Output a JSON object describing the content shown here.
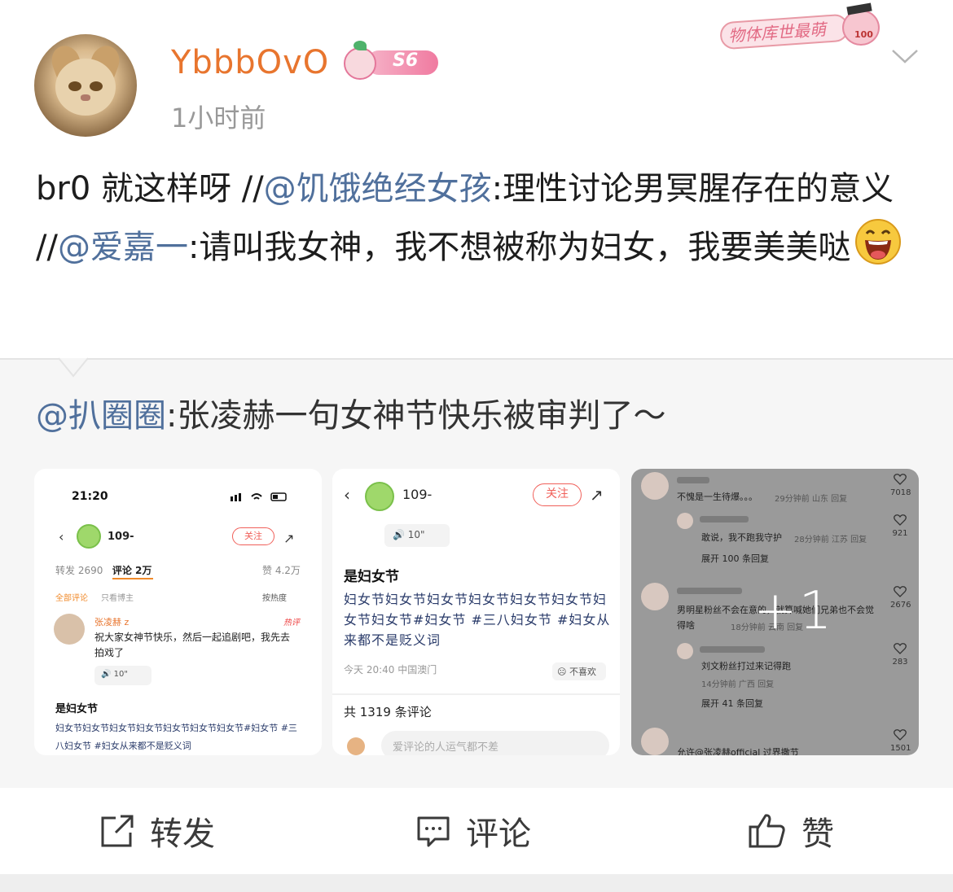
{
  "post": {
    "username": "YbbbOvO",
    "level_badge": "S6",
    "time": "1小时前",
    "stamp_text": "物体库世最萌",
    "stamp_num": "100",
    "text_1": "br0 就这样呀 //",
    "mention_1": "@饥饿绝经女孩",
    "text_2": ":理性讨论男冥腥存在的意义 //",
    "mention_2": "@爱嘉一",
    "text_3": ":请叫我女神，我不想被称为妇女，我要美美哒"
  },
  "repost": {
    "mention": "@扒圈圈",
    "text": ":张凌赫一句女神节快乐被审判了～",
    "image_more": "+1",
    "thumb1": {
      "status_time": "21:20",
      "username": "109-",
      "follow": "关注",
      "tab_repost": "转发 2690",
      "tab_comment": "评论 2万",
      "likes": "赞 4.2万",
      "all_comments": "全部评论",
      "only_blogger": "只看博主",
      "sort": "按热度",
      "commenter": "张凌赫 z",
      "hot_tag": "热评",
      "comment": "祝大家女神节快乐，然后一起追剧吧，我先去拍戏了",
      "voice": "10\"",
      "title": "是妇女节",
      "body": "妇女节妇女节妇女节妇女节妇女节妇女节妇女节#妇女节 #三八妇女节 #妇女从来都不是贬义词"
    },
    "thumb2": {
      "username": "109-",
      "follow": "关注",
      "voice": "10\"",
      "title": "是妇女节",
      "body": "妇女节妇女节妇女节妇女节妇女节妇女节妇女节妇女节#妇女节 #三八妇女节 #妇女从来都不是贬义词",
      "meta": "今天 20:40 中国澳门",
      "dislike": "不喜欢",
      "count": "共 1319 条评论",
      "input_placeholder": "爱评论的人运气都不差"
    },
    "thumb3": {
      "c1": "不愧是一生待爆。。。",
      "c1_meta": "29分钟前 山东 回复",
      "c1_likes": "7018",
      "c2": "敢说，我不跑我守护",
      "c2_meta": "28分钟前 江苏 回复",
      "c2_likes": "921",
      "expand1": "展开 100 条回复",
      "c3": "男明星粉丝不会在意的，就算喊她们兄弟也不会觉得啥",
      "c3_meta": "18分钟前 云南 回复",
      "c3_likes": "2676",
      "c4": "刘文粉丝打过来记得跑",
      "c4_meta": "14分钟前 广西 回复",
      "c4_likes": "283",
      "expand2": "展开 41 条回复",
      "c5": "允许@张凌赫official 过界撒节",
      "c5_likes": "1501"
    }
  },
  "actions": {
    "repost": "转发",
    "comment": "评论",
    "like": "赞"
  },
  "colors": {
    "username": "#e8752e",
    "mention": "#50709c",
    "card_bg": "#f6f6f6"
  }
}
